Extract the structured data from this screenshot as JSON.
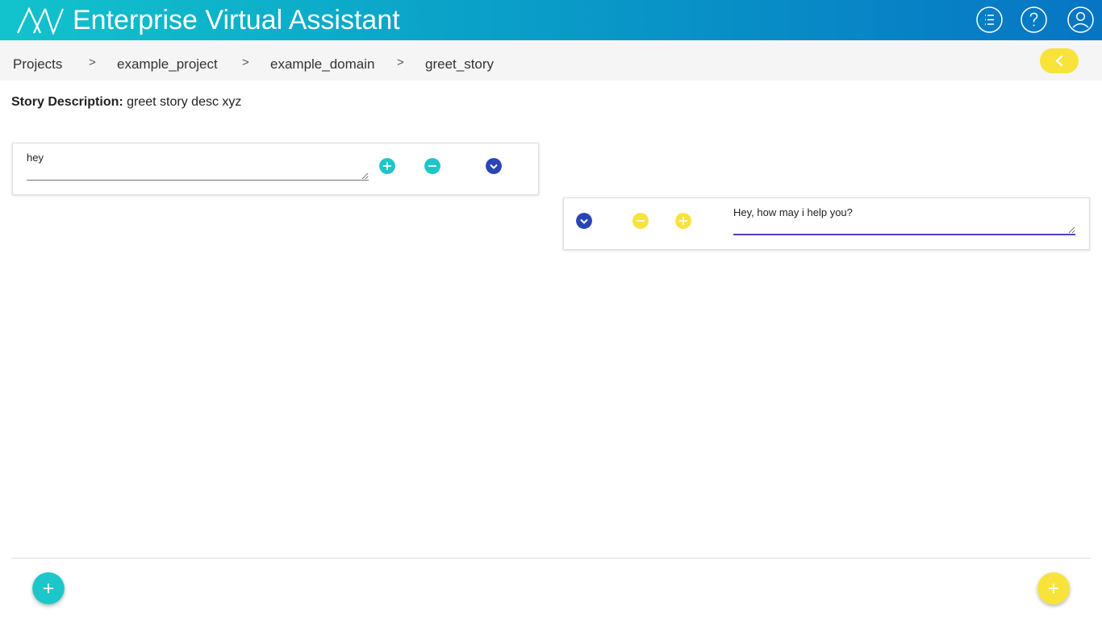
{
  "header": {
    "app_title": "Enterprise Virtual Assistant",
    "logo_icon": "av-logo-icon",
    "menu_icon": "list-icon",
    "help_icon": "help-icon",
    "user_icon": "user-icon"
  },
  "breadcrumb": {
    "items": [
      "Projects",
      "example_project",
      "example_domain",
      "greet_story"
    ],
    "separator": ">"
  },
  "story": {
    "description_label": "Story Description:",
    "description_value": "greet story desc xyz"
  },
  "user_card": {
    "text": "hey",
    "add_icon": "plus-circle-icon",
    "remove_icon": "minus-circle-icon",
    "expand_icon": "chevron-down-icon"
  },
  "bot_card": {
    "text": "Hey, how may i help you?",
    "expand_icon": "chevron-down-icon",
    "remove_icon": "minus-circle-icon",
    "add_icon": "plus-circle-icon"
  },
  "colors": {
    "teal": "#1cc7c9",
    "yellow": "#f7e33a",
    "blue": "#2a45b5",
    "header_start": "#12c3cc",
    "header_end": "#0675c4"
  }
}
